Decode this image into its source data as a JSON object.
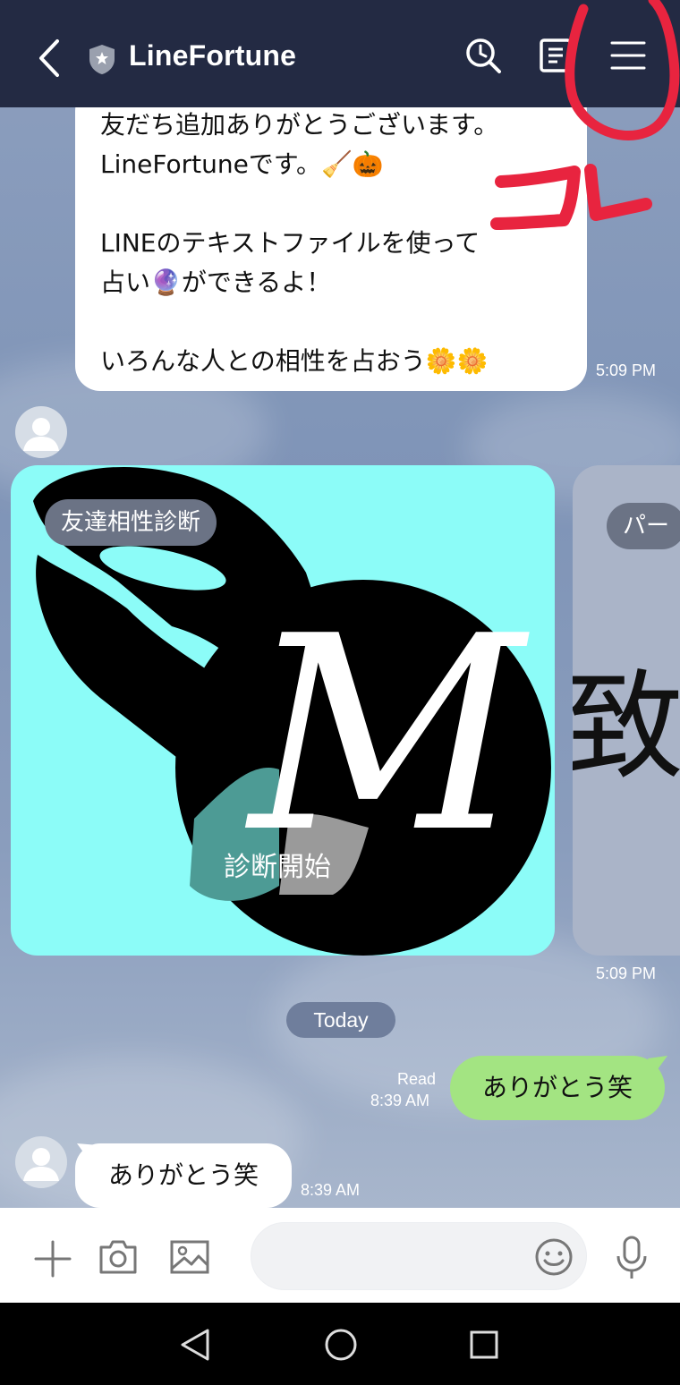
{
  "header": {
    "title": "LineFortune",
    "icons": [
      "back-icon",
      "shield-icon",
      "search-icon",
      "notes-icon",
      "menu-icon"
    ],
    "bg_color": "#232a43"
  },
  "annotation": {
    "text": "コレ",
    "color": "#e8243f"
  },
  "messages": {
    "welcome": {
      "lines": [
        "友だち追加ありがとうございます。",
        "LineFortuneです。🧹🎃",
        "",
        "LINEのテキストファイルを使って",
        "占い🔮ができるよ！",
        "",
        "いろんな人との相性を占おう🌼🌼"
      ],
      "time": "5:09 PM"
    },
    "cards": {
      "card1_tag": "友達相性診断",
      "card1_button": "診断開始",
      "card1_logo_letter": "M",
      "card2_tag": "パー",
      "card2_text": "致",
      "time": "5:09 PM"
    },
    "date_separator": "Today",
    "outgoing": {
      "text": "ありがとう笑",
      "status": "Read",
      "time": "8:39 AM"
    },
    "incoming": {
      "text": "ありがとう笑",
      "time": "8:39 AM"
    }
  },
  "input_bar": {
    "icons": [
      "plus-icon",
      "camera-icon",
      "image-icon",
      "emoji-icon",
      "mic-icon"
    ],
    "placeholder": ""
  },
  "nav_bar": {
    "icons": [
      "nav-back-icon",
      "nav-home-icon",
      "nav-recents-icon"
    ]
  },
  "colors": {
    "outgoing_bubble": "#a3e482",
    "card1_bg": "#8cfcf8",
    "card2_bg": "#aab4c8"
  }
}
